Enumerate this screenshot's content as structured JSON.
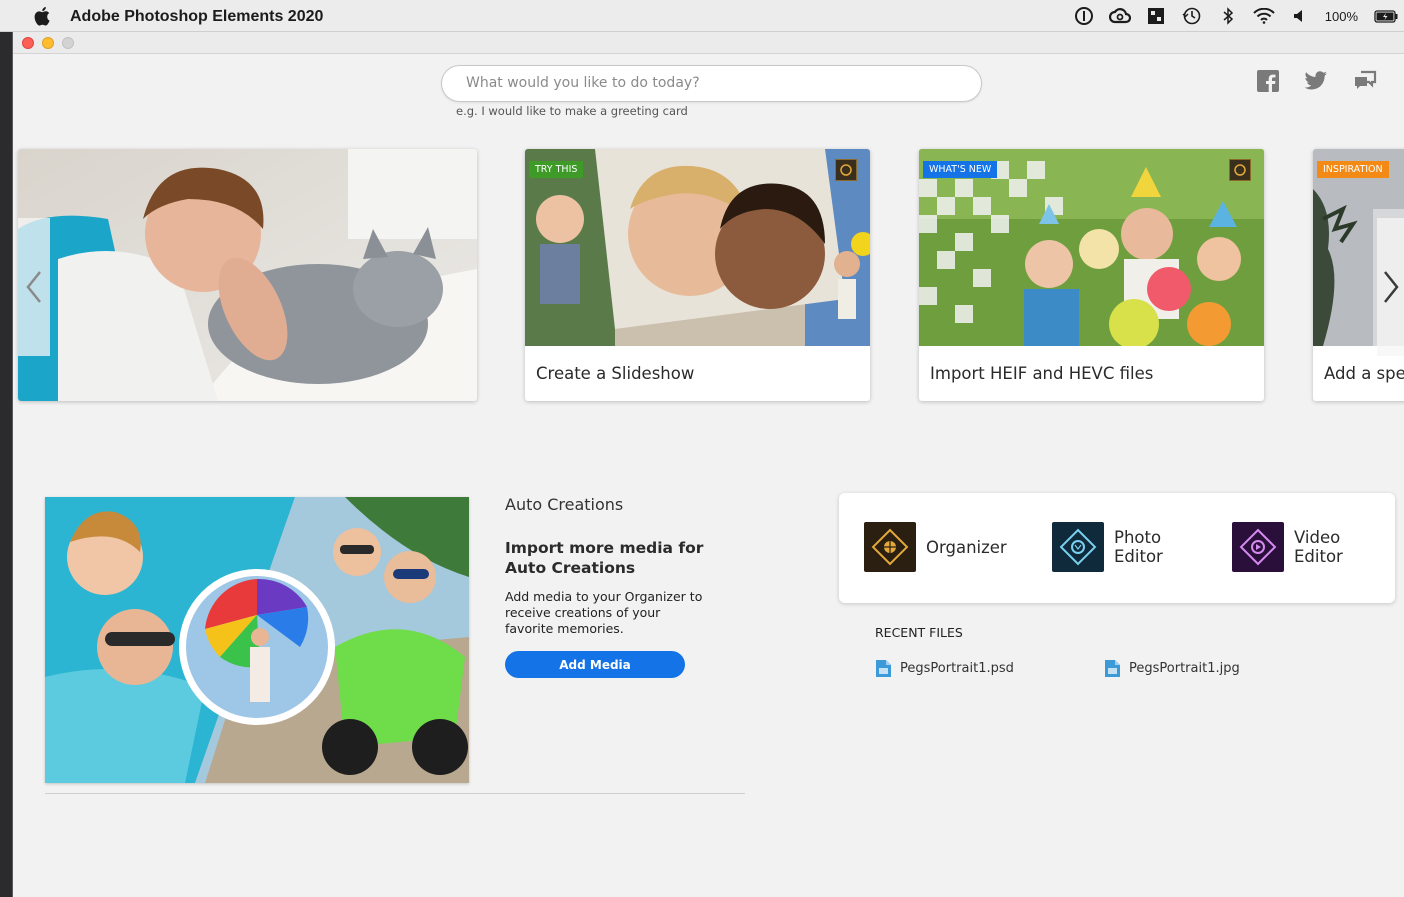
{
  "menubar": {
    "app_title": "Adobe Photoshop Elements 2020",
    "battery_percent": "100%",
    "tray_icons": [
      "onepassword-icon",
      "creative-cloud-icon",
      "nvidia-icon",
      "time-machine-icon",
      "bluetooth-icon",
      "wifi-icon",
      "volume-icon"
    ]
  },
  "search": {
    "placeholder": "What would you like to do today?",
    "hint": "e.g. I would like to make a greeting card"
  },
  "social": [
    "facebook-icon",
    "twitter-icon",
    "feedback-icon"
  ],
  "carousel": {
    "cards": [
      {
        "badge": "",
        "title": ""
      },
      {
        "badge": "TRY THIS",
        "title": "Create a Slideshow"
      },
      {
        "badge": "WHAT'S NEW",
        "title": "Import HEIF and HEVC files"
      },
      {
        "badge": "INSPIRATION",
        "title": "Add a spe"
      }
    ]
  },
  "auto_creations": {
    "heading": "Auto Creations",
    "title": "Import more media for Auto Creations",
    "description": "Add media to your Organizer to receive creations of your favorite memories.",
    "button": "Add Media"
  },
  "apps": [
    {
      "line1": "Organizer",
      "line2": ""
    },
    {
      "line1": "Photo",
      "line2": "Editor"
    },
    {
      "line1": "Video",
      "line2": "Editor"
    }
  ],
  "recent": {
    "heading": "RECENT FILES",
    "files": [
      "PegsPortrait1.psd",
      "PegsPortrait1.jpg"
    ]
  },
  "colors": {
    "accent_blue": "#1473e6",
    "badge_try_this": "#3f9b28",
    "badge_whats_new": "#1473e6",
    "badge_inspiration": "#f48a16"
  }
}
